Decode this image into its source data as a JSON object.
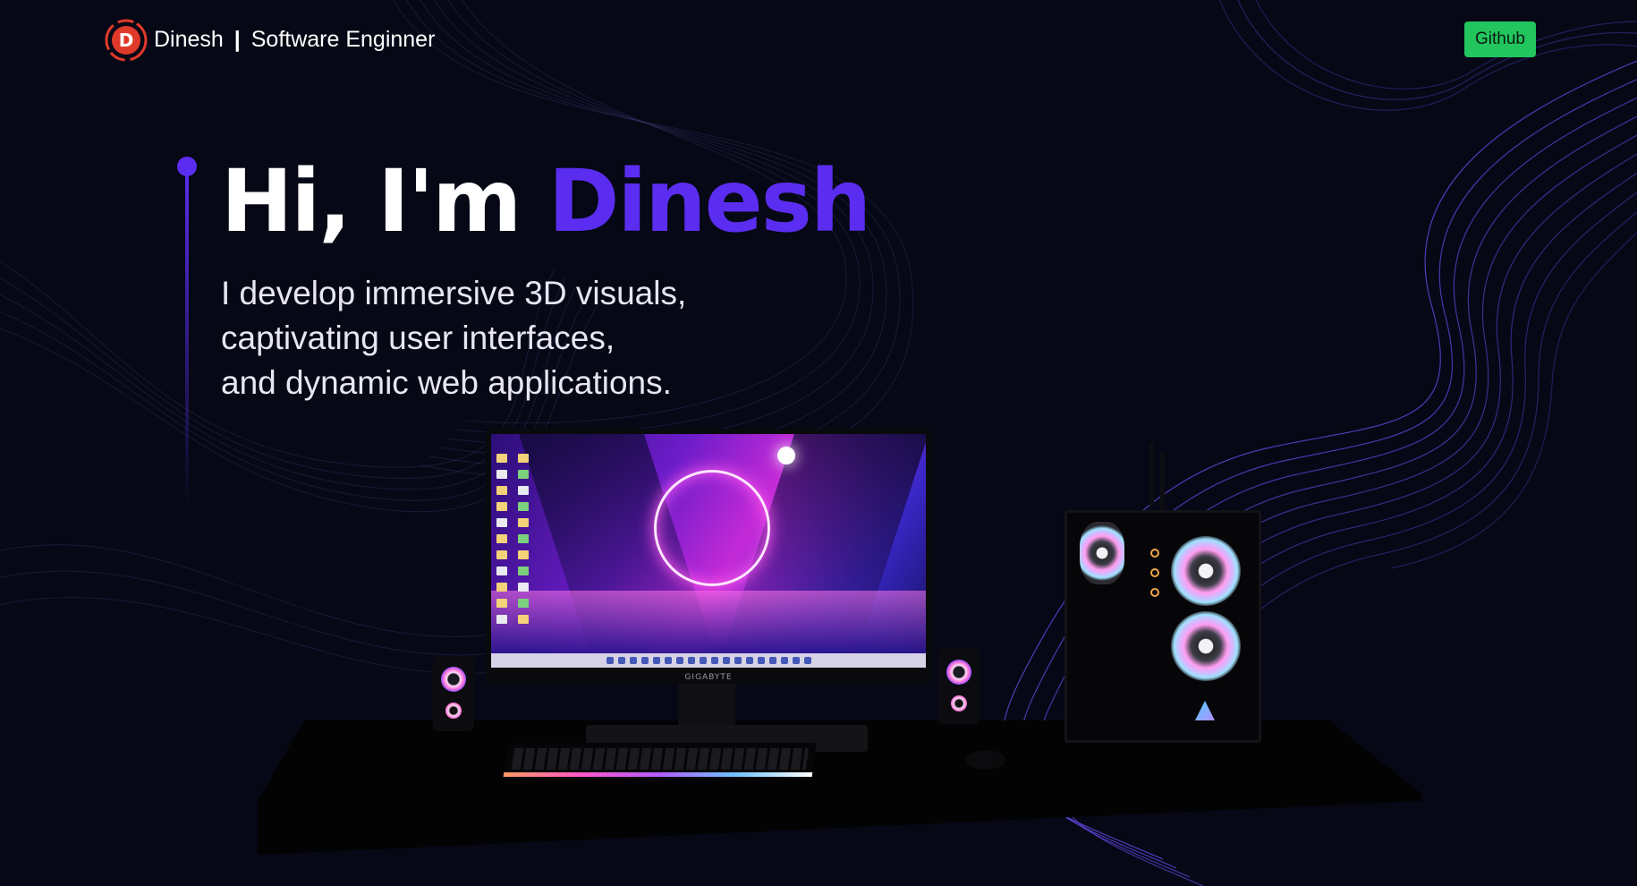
{
  "nav": {
    "logo_letter": "D",
    "brand_name": "Dinesh",
    "brand_separator": "|",
    "brand_title": "Software Enginner",
    "github_label": "Github"
  },
  "hero": {
    "greeting": "Hi, I'm",
    "name": "Dinesh",
    "lines": [
      "I develop immersive 3D visuals,",
      "captivating user interfaces,",
      "and dynamic web applications."
    ]
  },
  "scene": {
    "monitor_brand": "GIGABYTE"
  },
  "colors": {
    "background": "#060816",
    "accent": "#5b2df0",
    "github_button": "#22c55e",
    "logo_red": "#e03a2a",
    "wave_lines": "#6a4cf0"
  },
  "icons": [
    "logo-d-icon"
  ]
}
